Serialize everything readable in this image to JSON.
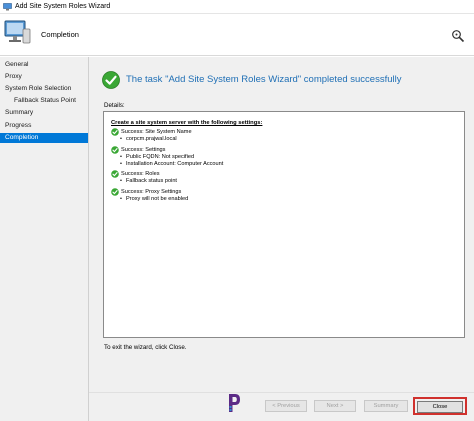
{
  "window": {
    "title": "Add Site System Roles Wizard"
  },
  "header": {
    "heading": "Completion"
  },
  "sidebar": {
    "items": [
      {
        "label": "General"
      },
      {
        "label": "Proxy"
      },
      {
        "label": "System Role Selection"
      },
      {
        "label": "Fallback Status Point"
      },
      {
        "label": "Summary"
      },
      {
        "label": "Progress"
      },
      {
        "label": "Completion"
      }
    ],
    "active_index": 6
  },
  "main": {
    "success_message": "The task \"Add Site System Roles Wizard\" completed successfully",
    "details_label": "Details:",
    "details_heading": "Create a site system server with the following settings:",
    "results": [
      {
        "title": "Success: Site System Name",
        "details": [
          "corpcm.prajwal.local"
        ]
      },
      {
        "title": "Success: Settings",
        "details": [
          "Public FQDN: Not specified",
          "Installation Account: Computer Account"
        ]
      },
      {
        "title": "Success: Roles",
        "details": [
          "Fallback status point"
        ]
      },
      {
        "title": "Success: Proxy Settings",
        "details": [
          "Proxy will not be enabled"
        ]
      }
    ],
    "exit_text": "To exit the wizard, click Close."
  },
  "footer": {
    "previous_label": "< Previous",
    "next_label": "Next >",
    "summary_label": "Summary",
    "close_label": "Close"
  },
  "colors": {
    "accent": "#0078d7",
    "success_text": "#1f6fb5",
    "success_icon": "#3aa735",
    "highlight_frame": "#d0312d"
  },
  "icons": {
    "app": "wizard-app-icon",
    "wizard": "computer-wizard-icon",
    "help": "help-icon",
    "success": "check-circle-icon",
    "logo": "prajwal-logo-icon"
  }
}
